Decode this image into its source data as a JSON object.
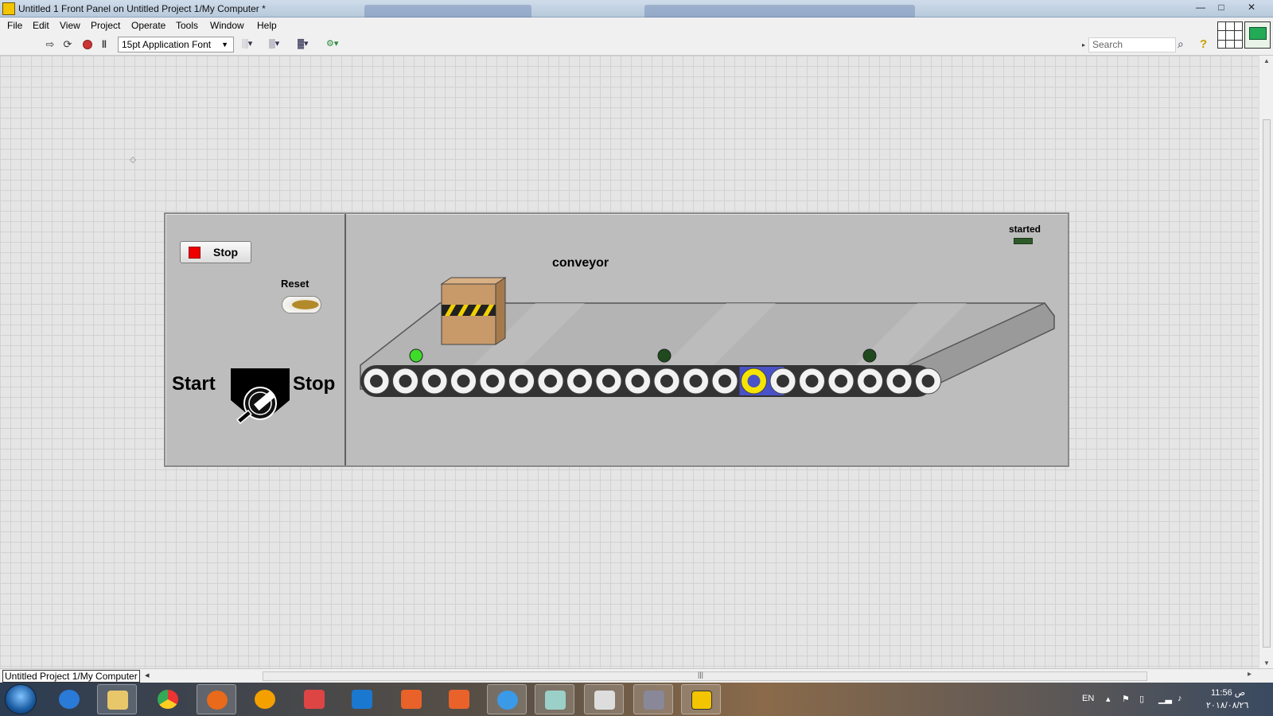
{
  "window": {
    "title": "Untitled 1 Front Panel on Untitled Project 1/My Computer *",
    "minimize": "—",
    "maximize": "□",
    "close": "✕"
  },
  "menu": [
    "File",
    "Edit",
    "View",
    "Project",
    "Operate",
    "Tools",
    "Window",
    "Help"
  ],
  "toolbar": {
    "font_select": "15pt Application Font",
    "search_placeholder": "Search",
    "help_glyph": "?"
  },
  "panel": {
    "stop_button_label": "Stop",
    "reset_label": "Reset",
    "start_label": "Start",
    "stop_label": "Stop",
    "conveyor_label": "conveyor",
    "started_label": "started",
    "conveyor_leds": [
      "on",
      "off",
      "off"
    ],
    "accent_colors": {
      "stop_red": "#ee0000",
      "led_on": "#3ddc2a",
      "led_off": "#1e4a1e",
      "roller_highlight": "#f5e400",
      "roller_highlight_bg": "#4a52c8",
      "box": "#c89a6a"
    },
    "roller_count": 20,
    "highlighted_roller_index": 13
  },
  "status": {
    "project_path": "Untitled Project 1/My Computer"
  },
  "taskbar": {
    "apps": [
      "start-orb",
      "internet-explorer-icon",
      "file-explorer-icon",
      "chrome-icon",
      "firefox-icon",
      "media-player-icon",
      "snipping-icon",
      "fs-icon",
      "office-icon",
      "camera-icon",
      "sync-icon",
      "notes-icon",
      "paint-icon",
      "settings-icon",
      "labview-icon"
    ],
    "language": "EN",
    "clock_time": "11:56 ص",
    "clock_date": "٢٠١٨/٠٨/٢٦"
  }
}
